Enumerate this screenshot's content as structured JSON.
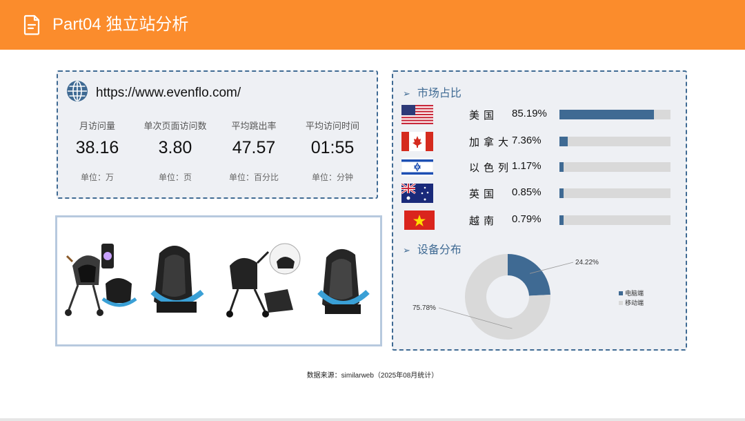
{
  "header": {
    "title": "Part04 独立站分析",
    "bg_color": "#fb8c2c",
    "icon": "document-icon"
  },
  "site": {
    "url": "https://www.evenflo.com/",
    "icon": "globe-icon",
    "metrics": [
      {
        "label": "月访问量",
        "value": "38.16",
        "unit": "单位：万"
      },
      {
        "label": "单次页面访问数",
        "value": "3.80",
        "unit": "单位：页"
      },
      {
        "label": "平均跳出率",
        "value": "47.57",
        "unit": "单位：百分比"
      },
      {
        "label": "平均访问时间",
        "value": "01:55",
        "unit": "单位：分钟"
      }
    ]
  },
  "market": {
    "title": "市场占比",
    "rows": [
      {
        "country": "美国",
        "pct": "85.19%",
        "value": 85.19,
        "flag": "usa-flag"
      },
      {
        "country": "加拿大",
        "pct": "7.36%",
        "value": 7.36,
        "flag": "canada-flag"
      },
      {
        "country": "以色列",
        "pct": "1.17%",
        "value": 1.17,
        "flag": "israel-flag"
      },
      {
        "country": "英国",
        "pct": "0.85%",
        "value": 0.85,
        "flag": "australia-flag"
      },
      {
        "country": "越南",
        "pct": "0.79%",
        "value": 0.79,
        "flag": "vietnam-flag"
      }
    ]
  },
  "device": {
    "title": "设备分布",
    "legend": [
      "电脑端",
      "移动端"
    ]
  },
  "chart_data": {
    "type": "pie",
    "categories": [
      "电脑端",
      "移动端"
    ],
    "values": [
      24.22,
      75.78
    ],
    "labels": [
      "24.22%",
      "75.78%"
    ],
    "colors": [
      "#3f6a93",
      "#d9d9d9"
    ],
    "legend_position": "right"
  },
  "footer": {
    "source": "数据来源：similarweb（2025年08月统计）"
  },
  "colors": {
    "accent": "#3f6a93",
    "panel_bg": "#eef0f4",
    "track": "#d9d9d9"
  }
}
